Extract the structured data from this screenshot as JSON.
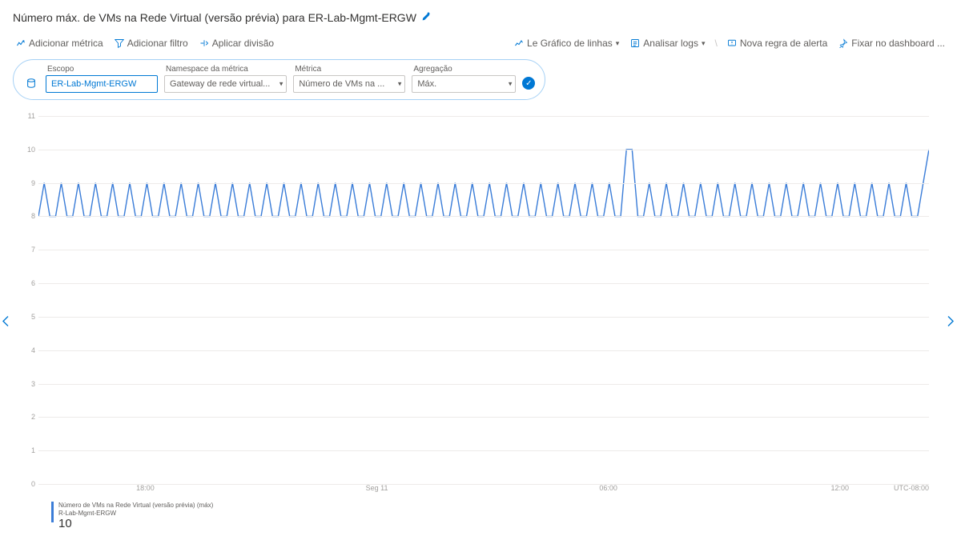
{
  "colors": {
    "accent": "#0078d4",
    "series": "#3b7dd8"
  },
  "title": "Número máx. de VMs na Rede Virtual (versão prévia) para ER-Lab-Mgmt-ERGW",
  "toolbar": {
    "add_metric": "Adicionar métrica",
    "add_filter": "Adicionar filtro",
    "apply_split": "Aplicar divisão",
    "chart_type": "Le Gráfico de linhas",
    "drill_logs": "Analisar logs",
    "new_alert": "Nova regra de alerta",
    "pin": "Fixar no dashboard ..."
  },
  "query": {
    "scope_label": "Escopo",
    "scope_value": "ER-Lab-Mgmt-ERGW",
    "namespace_label": "Namespace da métrica",
    "namespace_value": "Gateway de rede virtual...",
    "metric_label": "Métrica",
    "metric_value": "Número de VMs na ...",
    "aggregation_label": "Agregação",
    "aggregation_value": "Máx."
  },
  "legend": {
    "line1": "Número de VMs na Rede Virtual (versão prévia) (máx)",
    "line2": "R-Lab-Mgmt-ERGW",
    "value": "10"
  },
  "chart_data": {
    "type": "line",
    "title": "Número máx. de VMs na Rede Virtual (versão prévia) para ER-Lab-Mgmt-ERGW",
    "ylabel": "",
    "xlabel": "",
    "ylim": [
      0,
      11
    ],
    "y_ticks": [
      0,
      1,
      2,
      3,
      4,
      5,
      6,
      7,
      8,
      9,
      10,
      11
    ],
    "x_ticks": [
      "18:00",
      "Seg 11",
      "06:00",
      "12:00"
    ],
    "x_tick_positions": [
      0.12,
      0.38,
      0.64,
      0.9
    ],
    "timezone": "UTC-08:00",
    "series": [
      {
        "name": "Número de VMs na Rede Virtual (versão prévia) (máx)",
        "values": [
          8,
          9,
          8,
          8,
          9,
          8,
          8,
          9,
          8,
          8,
          9,
          8,
          8,
          9,
          8,
          8,
          9,
          8,
          8,
          9,
          8,
          8,
          9,
          8,
          8,
          9,
          8,
          8,
          9,
          8,
          8,
          9,
          8,
          8,
          9,
          8,
          8,
          9,
          8,
          8,
          9,
          8,
          8,
          9,
          8,
          8,
          9,
          8,
          8,
          9,
          8,
          8,
          9,
          8,
          8,
          9,
          8,
          8,
          9,
          8,
          8,
          9,
          8,
          8,
          9,
          8,
          8,
          9,
          8,
          8,
          9,
          8,
          8,
          9,
          8,
          8,
          9,
          8,
          8,
          9,
          8,
          8,
          9,
          8,
          8,
          9,
          8,
          8,
          9,
          8,
          8,
          9,
          8,
          8,
          9,
          8,
          8,
          9,
          8,
          8,
          9,
          8,
          8,
          10,
          10,
          8,
          8,
          9,
          8,
          8,
          9,
          8,
          8,
          9,
          8,
          8,
          9,
          8,
          8,
          9,
          8,
          8,
          9,
          8,
          8,
          9,
          8,
          8,
          9,
          8,
          8,
          9,
          8,
          8,
          9,
          8,
          8,
          9,
          8,
          8,
          9,
          8,
          8,
          9,
          8,
          8,
          9,
          8,
          8,
          9,
          8,
          8,
          9,
          8,
          8,
          9,
          10
        ]
      }
    ]
  }
}
